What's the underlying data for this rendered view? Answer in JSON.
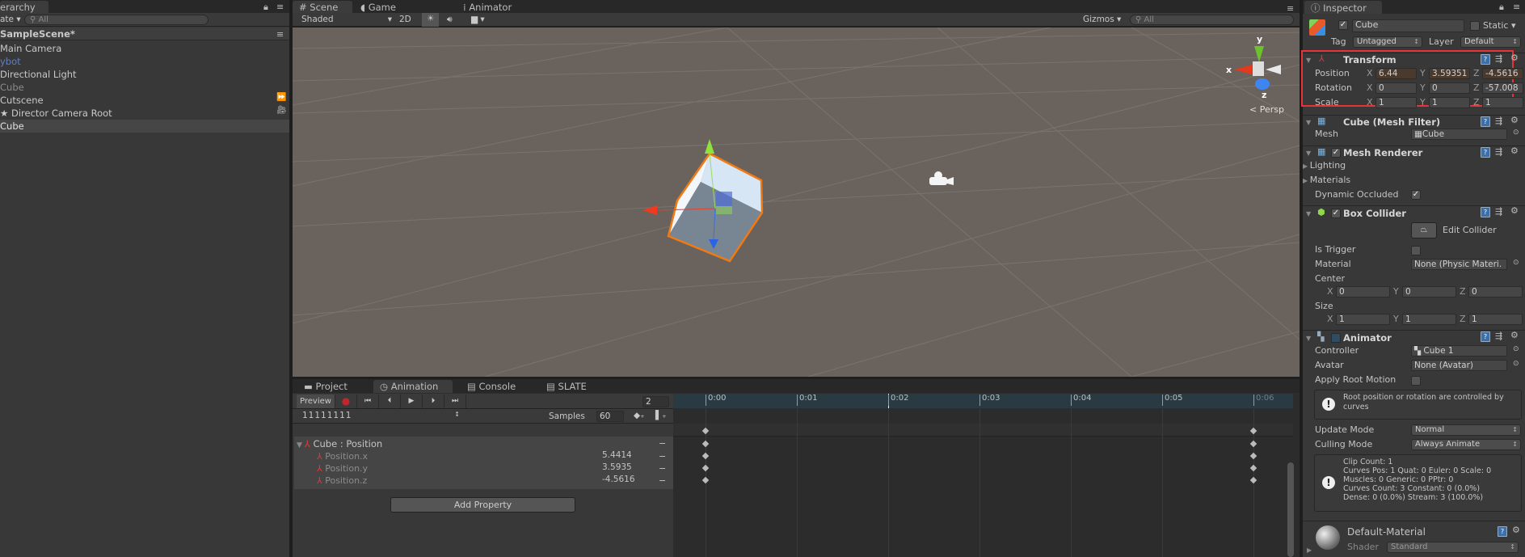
{
  "hierarchy": {
    "tab": "erarchy",
    "create": "ate ▾",
    "search_placeholder": "All",
    "scene": "SampleScene*",
    "items": [
      {
        "label": "Main Camera",
        "color": "#c8c8c8"
      },
      {
        "label": "ybot",
        "color": "#5f7fc4"
      },
      {
        "label": "Directional Light",
        "color": "#c8c8c8"
      },
      {
        "label": "Cube",
        "color": "#8a8a8a"
      },
      {
        "label": "Cutscene",
        "color": "#c8c8c8"
      },
      {
        "label": "★ Director Camera Root",
        "color": "#c8c8c8"
      },
      {
        "label": "Cube",
        "color": "#e0e0e0",
        "selected": true
      }
    ]
  },
  "scene": {
    "tabs": [
      "Scene",
      "Game",
      "Animator"
    ],
    "shading": "Shaded",
    "mode_2d": "2D",
    "gizmos": "Gizmos",
    "search_placeholder": "All",
    "persp": "Persp",
    "axis_y": "y",
    "axis_x": "x",
    "axis_z": "z"
  },
  "inspector": {
    "tab": "Inspector",
    "object_name": "Cube",
    "static_label": "Static",
    "tag_label": "Tag",
    "tag": "Untagged",
    "layer_label": "Layer",
    "layer": "Default",
    "transform": {
      "title": "Transform",
      "rows": [
        {
          "label": "Position",
          "x": "6.44",
          "y": "3.59351",
          "z": "-4.5616"
        },
        {
          "label": "Rotation",
          "x": "0",
          "y": "0",
          "z": "-57.008"
        },
        {
          "label": "Scale",
          "x": "1",
          "y": "1",
          "z": "1"
        }
      ]
    },
    "mesh_filter": {
      "title": "Cube (Mesh Filter)",
      "mesh_label": "Mesh",
      "mesh": "Cube"
    },
    "mesh_renderer": {
      "title": "Mesh Renderer",
      "lighting": "Lighting",
      "materials": "Materials",
      "dynamic_occluded": "Dynamic Occluded"
    },
    "box_collider": {
      "title": "Box Collider",
      "edit": "Edit Collider",
      "is_trigger": "Is Trigger",
      "material_label": "Material",
      "material": "None (Physic Materi.",
      "center": "Center",
      "center_xyz": [
        "0",
        "0",
        "0"
      ],
      "size": "Size",
      "size_xyz": [
        "1",
        "1",
        "1"
      ]
    },
    "animator": {
      "title": "Animator",
      "controller_label": "Controller",
      "controller": "Cube 1",
      "avatar_label": "Avatar",
      "avatar": "None (Avatar)",
      "apply_root": "Apply Root Motion",
      "warning": "Root position or rotation are controlled by curves",
      "update_label": "Update Mode",
      "update": "Normal",
      "culling_label": "Culling Mode",
      "culling": "Always Animate",
      "info": [
        "Clip Count: 1",
        "Curves Pos: 1 Quat: 0 Euler: 0 Scale: 0",
        "Muscles: 0 Generic: 0 PPtr: 0",
        "Curves Count: 3 Constant: 0 (0.0%)",
        "Dense: 0 (0.0%) Stream: 3 (100.0%)"
      ]
    },
    "material": {
      "name": "Default-Material",
      "shader_label": "Shader",
      "shader": "Standard"
    }
  },
  "animation": {
    "tabs": [
      "Project",
      "Animation",
      "Console",
      "SLATE"
    ],
    "preview": "Preview",
    "frame": "2",
    "clip": "11111111",
    "samples_label": "Samples",
    "samples": "60",
    "property_group": "Cube : Position",
    "properties": [
      {
        "name": "Position.x",
        "value": "5.4414"
      },
      {
        "name": "Position.y",
        "value": "3.5935"
      },
      {
        "name": "Position.z",
        "value": "-4.5616"
      }
    ],
    "add_property": "Add Property",
    "ticks": [
      "0:00",
      "0:01",
      "0:02",
      "0:03",
      "0:04",
      "0:05",
      "0:06"
    ],
    "playhead_time": "0:02",
    "keyframe_times": [
      "0:00",
      "0:06"
    ]
  },
  "colors": {
    "accent_record": "#c0262a",
    "selection_outline": "#f07a14",
    "highlight_box": "#e8323a"
  }
}
